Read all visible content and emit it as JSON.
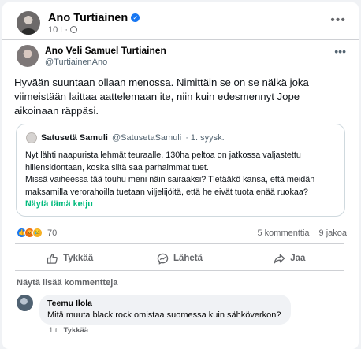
{
  "post": {
    "author": "Ano Turtiainen",
    "time": "10 t",
    "separator": "·"
  },
  "tweet": {
    "name": "Ano Veli Samuel Turtiainen",
    "handle": "@TurtiainenAno",
    "text": "Hyvään suuntaan ollaan menossa. Nimittäin se on se nälkä joka viimeistään laittaa aattelemaan ite, niin kuin edesmennyt Jope aikoinaan räppäsi."
  },
  "quoted": {
    "name": "Satusetä Samuli",
    "handle": "@SatusetaSamuli",
    "date": "· 1. syysk.",
    "text": "Nyt lähti naapurista lehmät teuraalle. 130ha peltoa on jatkossa valjastettu hiilensidontaan, koska siitä saa parhaimmat tuet.\nMissä vaiheessa tää touhu meni näin sairaaksi? Tietääkö kansa, että meidän maksamilla verorahoilla tuetaan viljelijöitä, että he eivät tuota enää ruokaa?",
    "show_thread": "Näytä tämä ketju"
  },
  "stats": {
    "reaction_count": "70",
    "comments": "5 kommenttia",
    "shares": "9 jakoa"
  },
  "actions": {
    "like": "Tykkää",
    "comment": "Lähetä",
    "share": "Jaa"
  },
  "comments": {
    "show_more": "Näytä lisää kommentteja",
    "items": [
      {
        "author": "Teemu Ilola",
        "text": "Mitä muuta black rock omistaa suomessa kuin sähköverkon?",
        "time": "1 t",
        "like_label": "Tykkää"
      }
    ]
  },
  "colors": {
    "facebook_blue": "#1877f2",
    "secondary_text": "#65676b",
    "twitter_green_link": "#00ba7c"
  }
}
